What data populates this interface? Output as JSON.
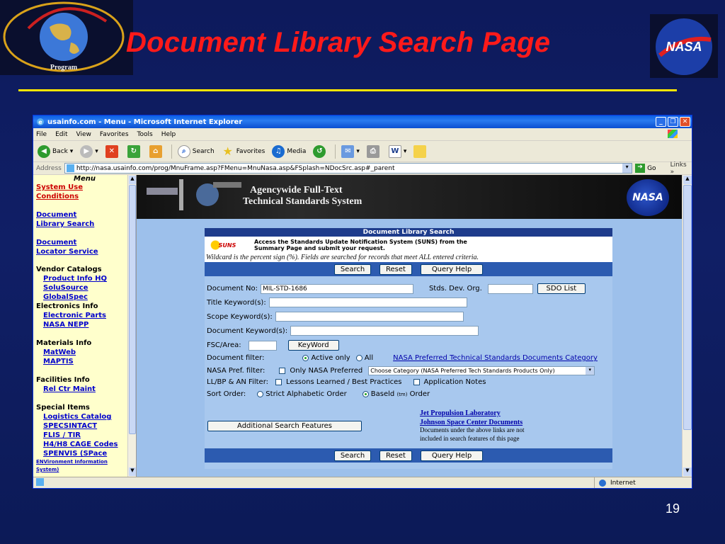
{
  "slide": {
    "title": "Document Library Search Page",
    "left_logo_text": "NASA Technical Standards Program",
    "right_logo_text": "NASA",
    "page_number": "19",
    "rule_color": "#ffe600",
    "title_color": "#ff1a1a"
  },
  "browser": {
    "window_title": "usainfo.com - Menu - Microsoft Internet Explorer",
    "menu": [
      "File",
      "Edit",
      "View",
      "Favorites",
      "Tools",
      "Help"
    ],
    "toolbar": {
      "back": "Back",
      "search": "Search",
      "favorites": "Favorites",
      "media": "Media"
    },
    "address_label": "Address",
    "address": "http://nasa.usainfo.com/prog/MnuFrame.asp?FMenu=MnuNasa.asp&FSplash=NDocSrc.asp#_parent",
    "go": "Go",
    "links": "Links",
    "status_zone": "Internet"
  },
  "left_menu": {
    "title": "Menu",
    "system_use": [
      "System Use",
      "Conditions"
    ],
    "document_library_search": [
      "Document",
      "Library Search"
    ],
    "document_locator": [
      "Document",
      "Locator Service"
    ],
    "vendor_catalogs": "Vendor Catalogs",
    "vendor_links": [
      "Product Info HQ",
      "SoluSource",
      "GlobalSpec"
    ],
    "electronics_info": "Electronics Info",
    "electronics_links": [
      "Electronic Parts",
      "NASA NEPP"
    ],
    "materials_info": "Materials Info",
    "materials_links": [
      "MatWeb",
      "MAPTIS"
    ],
    "facilities_info": "Facilities Info",
    "facilities_links": [
      "Rel Ctr Maint"
    ],
    "special_items": "Special Items",
    "special_links": [
      "Logistics Catalog",
      "SPECSINTACT",
      "FLIS / TIR",
      "H4/H8 CAGE Codes",
      "SPENVIS (SPace",
      "ENVironment Information",
      "System)"
    ]
  },
  "banner": {
    "line1": "Agencywide Full-Text",
    "line2": "Technical Standards System",
    "nasa": "NASA"
  },
  "search": {
    "heading": "Document Library Search",
    "suns_logo": "SUNS",
    "suns_text_1": "Access the Standards Update Notification System (SUNS) from the",
    "suns_text_2": "Summary Page and submit your request.",
    "wildcard": "Wildcard is the percent sign (%). Fields are searched for records that meet ALL entered criteria.",
    "buttons": {
      "search": "Search",
      "reset": "Reset",
      "query_help": "Query Help"
    },
    "document_no_label": "Document No:",
    "document_no_value": "MIL-STD-1686",
    "stds_dev_org_label": "Stds. Dev. Org.",
    "sdo_list": "SDO List",
    "title_keyword_label": "Title Keyword(s):",
    "scope_keyword_label": "Scope Keyword(s):",
    "document_keyword_label": "Document Keyword(s):",
    "fsc_area_label": "FSC/Area:",
    "keyword_button": "KeyWord",
    "document_filter_label": "Document filter:",
    "active_only": "Active only",
    "all": "All",
    "nasa_pref_category_link": "NASA Preferred Technical Standards Documents Category",
    "nasa_pref_filter_label": "NASA Pref. filter:",
    "only_nasa_preferred": "Only NASA Preferred",
    "category_select": "Choose Category (NASA Preferred Tech Standards Products Only)",
    "llbp_label": "LL/BP & AN Filter:",
    "lessons_learned": "Lessons Learned / Best Practices",
    "application_notes": "Application Notes",
    "sort_order_label": "Sort Order:",
    "strict_alpha": "Strict Alphabetic Order",
    "baseld": "Baseld",
    "tm": "(tm)",
    "order": "Order",
    "additional_features": "Additional Search Features",
    "jpl_link": "Jet Propulsion Laboratory",
    "jsc_link": "Johnson Space Center Documents",
    "note_1": "Documents under the above links are not",
    "note_2": "included in search features of this page"
  }
}
